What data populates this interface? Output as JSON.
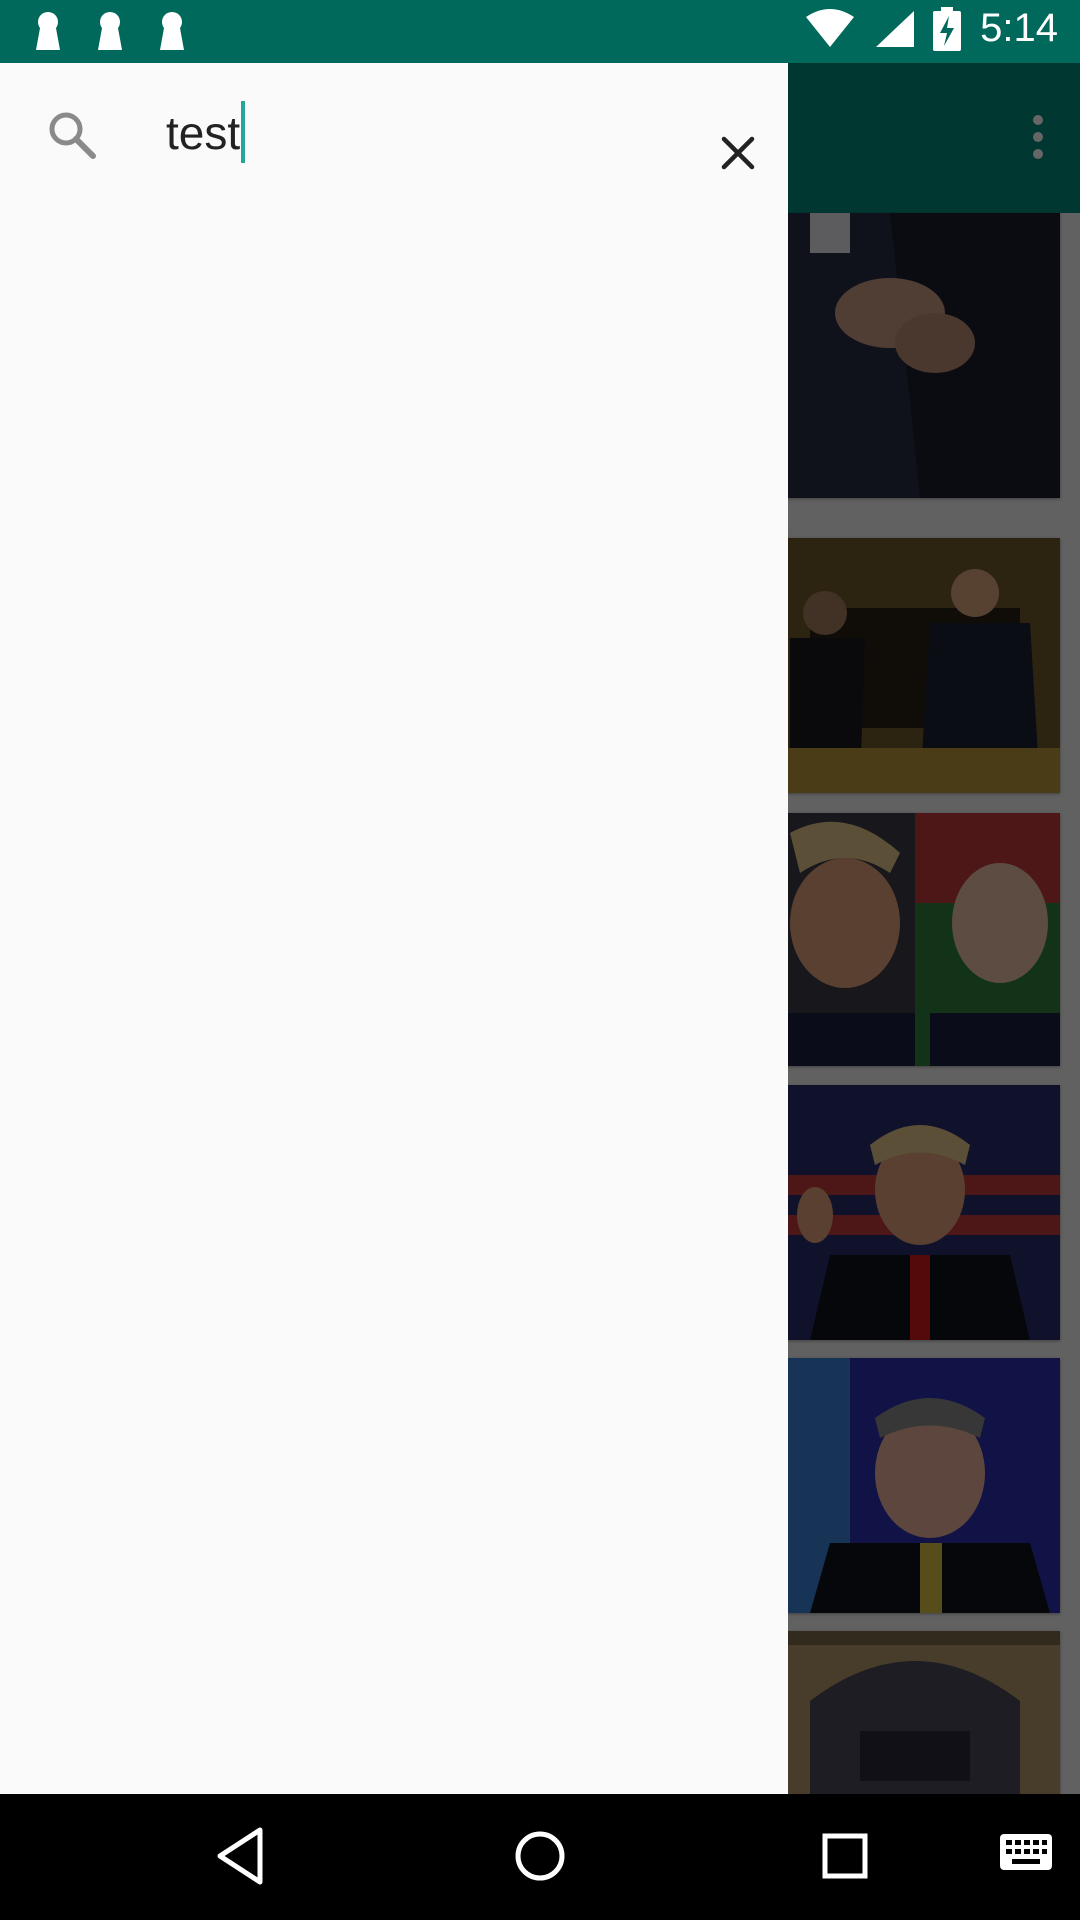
{
  "status_bar": {
    "time": "5:14",
    "notification_icons": [
      "keyhole-icon",
      "keyhole-icon",
      "keyhole-icon"
    ],
    "system_icons": [
      "wifi-icon",
      "signal-icon",
      "battery-charging-icon"
    ],
    "background_color": "#00695c"
  },
  "search": {
    "query": "test",
    "search_icon": "search-icon",
    "clear_icon": "close-icon",
    "caret_color": "#26a69a"
  },
  "background_app": {
    "toolbar_color": "#00897b",
    "menu_icon": "overflow-menu-icon",
    "feed_items": [
      {
        "image": "news-photo"
      },
      {
        "image": "news-photo"
      },
      {
        "image": "news-photo"
      },
      {
        "image": "news-photo"
      },
      {
        "image": "news-photo"
      },
      {
        "image": "news-photo"
      }
    ]
  },
  "nav_bar": {
    "buttons": [
      "back-icon",
      "home-icon",
      "recents-icon",
      "keyboard-icon"
    ]
  }
}
